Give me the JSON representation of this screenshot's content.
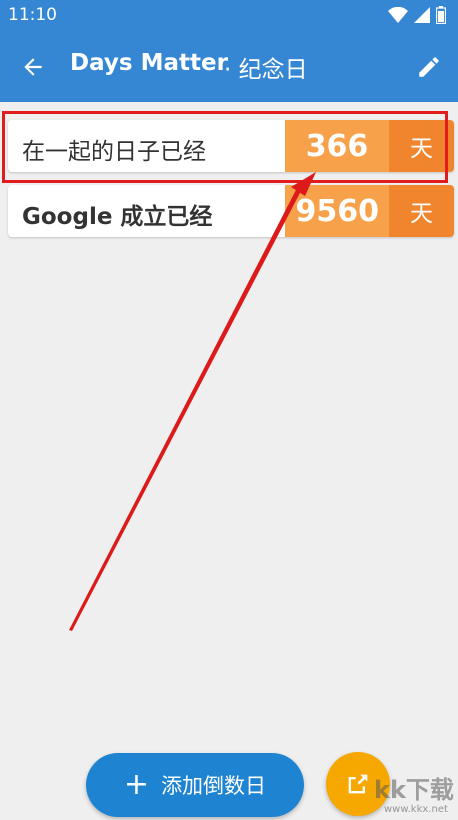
{
  "status_bar": {
    "time": "11:10"
  },
  "app_bar": {
    "title": "Days Matter",
    "subtitle": "· 纪念日"
  },
  "events": [
    {
      "name": "在一起的日子已经",
      "count": "366",
      "unit": "天"
    },
    {
      "name": "Google 成立已经",
      "count": "9560",
      "unit": "天"
    }
  ],
  "fab": {
    "add_label": "添加倒数日"
  },
  "watermark": {
    "logo": "kk下载",
    "url": "www.kkx.net"
  },
  "colors": {
    "primary": "#3587d3",
    "count_bg": "#f7a24a",
    "unit_bg": "#f0852e",
    "highlight": "#e01c1c",
    "share_bg": "#f7a800",
    "add_bg": "#1e84d2"
  }
}
